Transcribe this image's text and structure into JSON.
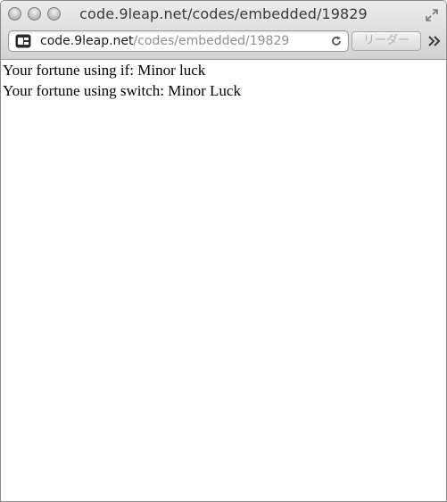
{
  "window": {
    "title": "code.9leap.net/codes/embedded/19829"
  },
  "toolbar": {
    "url_host": "code.9leap.net",
    "url_path": "/codes/embedded/19829",
    "reader_label": "リーダー",
    "site_icon": "9leap-site-icon",
    "reload_icon": "reload-icon",
    "more_icon": "double-chevron-right-icon",
    "resize_icon": "fullscreen-arrows-icon"
  },
  "content": {
    "lines": [
      "Your fortune using if: Minor luck",
      "Your fortune using switch: Minor Luck"
    ]
  }
}
